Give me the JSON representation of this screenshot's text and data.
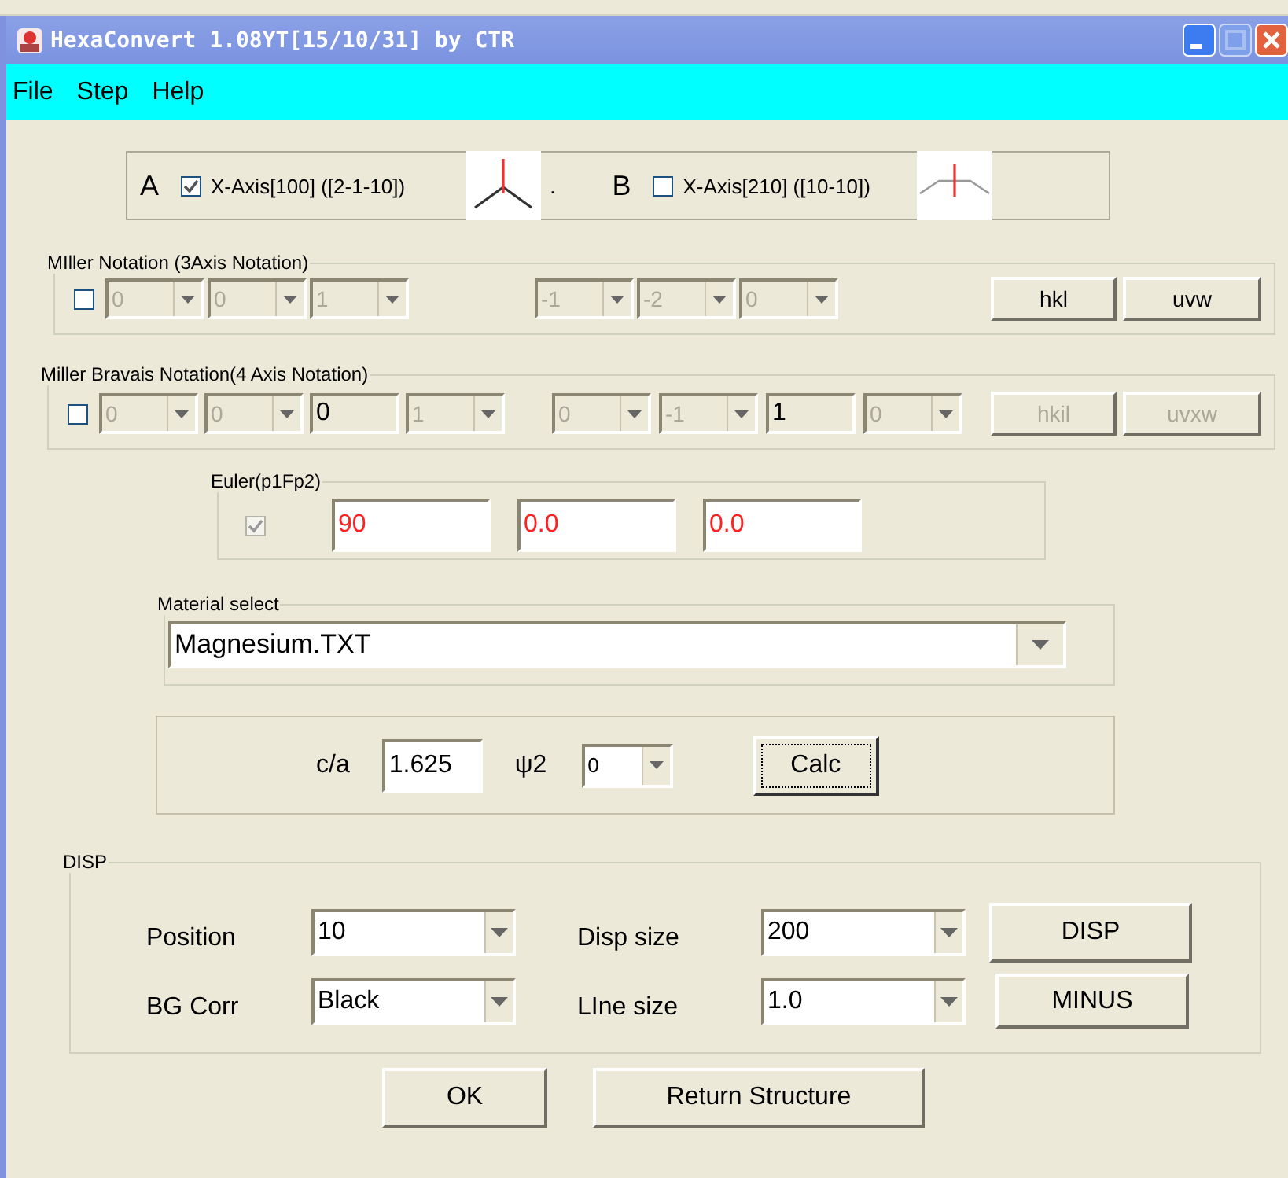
{
  "window": {
    "title": "HexaConvert 1.08YT[15/10/31] by CTR"
  },
  "menu": [
    {
      "label": "File"
    },
    {
      "label": "Step"
    },
    {
      "label": "Help"
    }
  ],
  "axis_options": [
    {
      "letter": "A",
      "label": "X-Axis[100] ([2-1-10])",
      "checked": true,
      "sep": "."
    },
    {
      "letter": "B",
      "label": "X-Axis[210] ([10-10])",
      "checked": false
    }
  ],
  "miller_3axis": {
    "legend": "MIller Notation (3Axis Notation)",
    "checked": false,
    "plane": [
      {
        "value": "0",
        "disabled": true
      },
      {
        "value": "0",
        "disabled": true
      },
      {
        "value": "1",
        "disabled": true
      }
    ],
    "direction": [
      {
        "value": "-1",
        "disabled": true
      },
      {
        "value": "-2",
        "disabled": true
      },
      {
        "value": "0",
        "disabled": true
      }
    ],
    "buttons": [
      {
        "label": "hkl",
        "disabled": false
      },
      {
        "label": "uvw",
        "disabled": false
      }
    ]
  },
  "miller_bravais": {
    "legend": "Miller Bravais Notation(4 Axis Notation)",
    "checked": false,
    "plane": [
      {
        "kind": "combo",
        "value": "0",
        "disabled": true
      },
      {
        "kind": "combo",
        "value": "0",
        "disabled": true
      },
      {
        "kind": "text",
        "value": "0",
        "disabled": false
      },
      {
        "kind": "combo",
        "value": "1",
        "disabled": true
      }
    ],
    "direction": [
      {
        "kind": "combo",
        "value": "0",
        "disabled": true
      },
      {
        "kind": "combo",
        "value": "-1",
        "disabled": true
      },
      {
        "kind": "text",
        "value": "1",
        "disabled": false
      },
      {
        "kind": "combo",
        "value": "0",
        "disabled": true
      }
    ],
    "buttons": [
      {
        "label": "hkil",
        "disabled": true
      },
      {
        "label": "uvxw",
        "disabled": true
      }
    ]
  },
  "euler": {
    "legend": "Euler(p1Fp2)",
    "checked": true,
    "disabled": true,
    "values": [
      "90",
      "0.0",
      "0.0"
    ]
  },
  "material": {
    "legend": "Material select",
    "value": "Magnesium.TXT"
  },
  "calc": {
    "ca_label": "c/a",
    "ca_value": "1.625",
    "psi_label": "ψ2",
    "psi_value": "0",
    "button": "Calc"
  },
  "disp": {
    "legend": "DISP",
    "rows": [
      {
        "left_label": "Position",
        "left_value": "10",
        "right_label": "Disp size",
        "right_value": "200",
        "button": "DISP"
      },
      {
        "left_label": "BG Corr",
        "left_value": "Black",
        "right_label": "LIne size",
        "right_value": "1.0",
        "button": "MINUS"
      }
    ]
  },
  "footer_buttons": [
    "OK",
    "Return Structure"
  ]
}
